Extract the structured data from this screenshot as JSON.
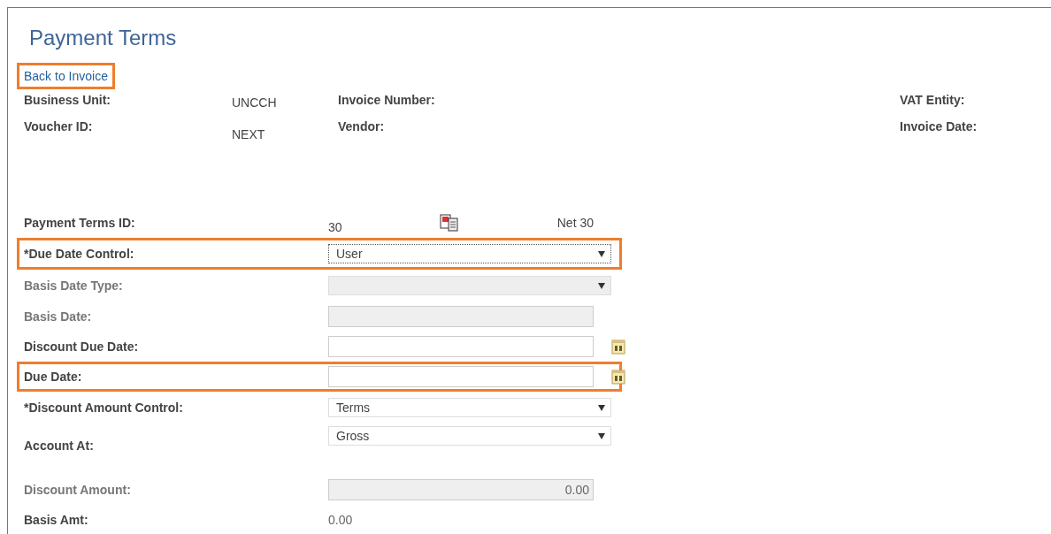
{
  "title": "Payment Terms",
  "back_link": {
    "label": "Back to Invoice",
    "highlighted": true
  },
  "header_rows": [
    {
      "label": "Business Unit:",
      "value": "UNCCH",
      "label_2": "Invoice Number:",
      "label_3": "VAT Entity:"
    },
    {
      "label": "Voucher ID:",
      "value": "NEXT",
      "label_2": "Vendor:",
      "label_3": "Invoice Date:"
    }
  ],
  "fields": [
    {
      "kind": "text",
      "label": "Payment Terms ID:",
      "value": "30",
      "description": "Net 30",
      "highlighted": false,
      "disabled": false
    },
    {
      "kind": "select",
      "label": "*Due Date Control:",
      "value": "User",
      "highlighted": true,
      "disabled": false,
      "focused": true
    },
    {
      "kind": "select",
      "label": "Basis Date Type:",
      "highlighted": false,
      "disabled": true,
      "focused": false
    },
    {
      "kind": "input",
      "label": "Basis Date:",
      "highlighted": false,
      "disabled": true
    },
    {
      "kind": "date",
      "label": "Discount Due Date:",
      "highlighted": false,
      "disabled": false
    },
    {
      "kind": "date",
      "label": "Due Date:",
      "highlighted": true,
      "disabled": false
    },
    {
      "kind": "select",
      "label": "*Discount Amount Control:",
      "value": "Terms",
      "highlighted": false,
      "disabled": false,
      "focused": false
    },
    {
      "kind": "select",
      "label": "Account At:",
      "value": "Gross",
      "highlighted": false,
      "disabled": false,
      "focused": false
    },
    {
      "kind": "input",
      "label": "Discount Amount:",
      "value": "0.00",
      "highlighted": false,
      "disabled": true
    },
    {
      "kind": "amount",
      "label": "Basis Amt:",
      "value": "0.00",
      "highlighted": false,
      "disabled": false
    }
  ]
}
